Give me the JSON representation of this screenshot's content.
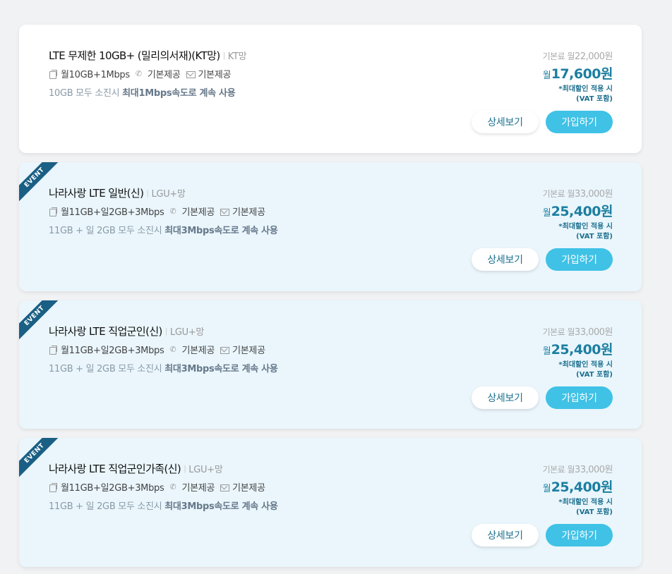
{
  "plans": [
    {
      "event": false,
      "event_label": "",
      "title": "LTE 무제한 10GB+ (밀리의서재)(KT망)",
      "network": "KT망",
      "data": "월10GB+1Mbps",
      "call": "기본제공",
      "sms": "기본제공",
      "note_prefix": "10GB 모두 소진시 ",
      "note_bold": "최대1Mbps속도로 계속 사용",
      "base_label": "기본료 월",
      "base_price": "22,000원",
      "price_prefix": "월",
      "price": "17,600원",
      "discount_line1": "*최대할인 적용 시",
      "discount_line2": "(VAT 포함)",
      "detail_label": "상세보기",
      "join_label": "가입하기"
    },
    {
      "event": true,
      "event_label": "EVENT",
      "title": "나라사랑 LTE 일반(신)",
      "network": "LGU+망",
      "data": "월11GB+일2GB+3Mbps",
      "call": "기본제공",
      "sms": "기본제공",
      "note_prefix": "11GB + 일 2GB 모두 소진시 ",
      "note_bold": "최대3Mbps속도로 계속 사용",
      "base_label": "기본료 월",
      "base_price": "33,000원",
      "price_prefix": "월",
      "price": "25,400원",
      "discount_line1": "*최대할인 적용 시",
      "discount_line2": "(VAT 포함)",
      "detail_label": "상세보기",
      "join_label": "가입하기"
    },
    {
      "event": true,
      "event_label": "EVENT",
      "title": "나라사랑 LTE 직업군인(신)",
      "network": "LGU+망",
      "data": "월11GB+일2GB+3Mbps",
      "call": "기본제공",
      "sms": "기본제공",
      "note_prefix": "11GB + 일 2GB 모두 소진시 ",
      "note_bold": "최대3Mbps속도로 계속 사용",
      "base_label": "기본료 월",
      "base_price": "33,000원",
      "price_prefix": "월",
      "price": "25,400원",
      "discount_line1": "*최대할인 적용 시",
      "discount_line2": "(VAT 포함)",
      "detail_label": "상세보기",
      "join_label": "가입하기"
    },
    {
      "event": true,
      "event_label": "EVENT",
      "title": "나라사랑 LTE 직업군인가족(신)",
      "network": "LGU+망",
      "data": "월11GB+일2GB+3Mbps",
      "call": "기본제공",
      "sms": "기본제공",
      "note_prefix": "11GB + 일 2GB 모두 소진시 ",
      "note_bold": "최대3Mbps속도로 계속 사용",
      "base_label": "기본료 월",
      "base_price": "33,000원",
      "price_prefix": "월",
      "price": "25,400원",
      "discount_line1": "*최대할인 적용 시",
      "discount_line2": "(VAT 포함)",
      "detail_label": "상세보기",
      "join_label": "가입하기"
    }
  ],
  "icons": {
    "data": "data-icon",
    "call": "phone-icon",
    "sms": "message-icon"
  },
  "colors": {
    "accent": "#1c7ea0",
    "join_button": "#3fc2e6",
    "event_ribbon": "#1a5f84",
    "event_card_bg": "#eaf6fc"
  }
}
